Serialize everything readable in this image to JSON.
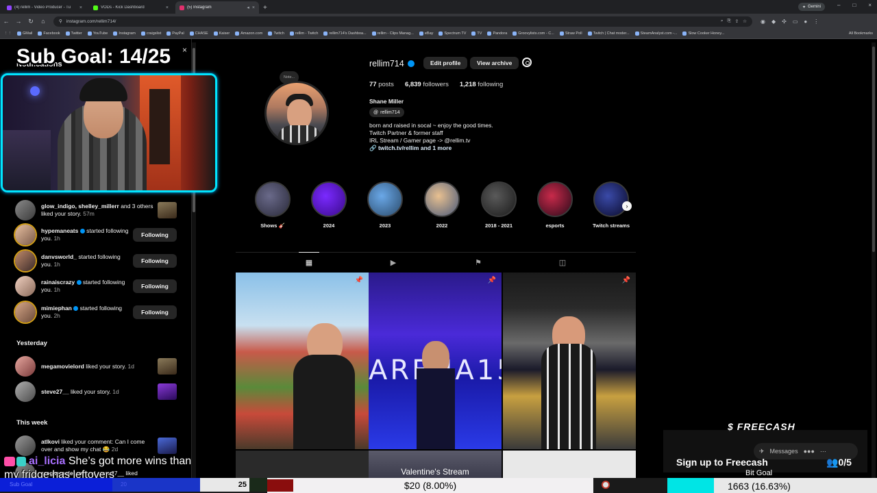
{
  "browser": {
    "tabs": [
      {
        "title": "(4) rellim - Video Producer - Tu",
        "favicon_color": "#9146ff",
        "active": false
      },
      {
        "title": "VODs - Kick Dashboard",
        "favicon_color": "#53fc18",
        "active": false
      },
      {
        "title": "(5) Instagram",
        "favicon_color": "#e1306c",
        "active": true
      }
    ],
    "new_tab_label": "+",
    "gemini_label": "Gemini",
    "url": "instagram.com/rellim714/",
    "window_controls": [
      "–",
      "□",
      "×"
    ],
    "bookmarks": [
      "GMail",
      "Facebook",
      "Twitter",
      "YouTube",
      "Instagram",
      "craigslist",
      "PayPal",
      "CHASE",
      "Kaiser",
      "Amazon.com",
      "Twitch",
      "rellim - Twitch",
      "rellim714's Dashboa...",
      "rellim - Clips Manag...",
      "eBay",
      "Spectrum TV",
      "TV",
      "Pandora",
      "Groovylists.com - C...",
      "Straw Poll",
      "Twitch | Chat moder...",
      "SteamAnalyst.com -...",
      "Slow Cooker Honey..."
    ],
    "all_bookmarks": "All Bookmarks"
  },
  "overlay": {
    "sub_goal_title": "Sub Goal: 14/25",
    "notifications_heading": "Notifications",
    "close_symbol": "×"
  },
  "notifications": {
    "items": [
      {
        "user": "glow_indigo, shelley_millerr",
        "text": " and 3 others liked your story.",
        "time": "57m",
        "action": "thumb"
      },
      {
        "user": "hypemaneats",
        "verified": true,
        "text": " started following you.",
        "time": "1h",
        "action": "Following"
      },
      {
        "user": "danvsworld_",
        "text": " started following you.",
        "time": "1h",
        "action": "Following"
      },
      {
        "user": "rainaiscrazy",
        "verified": true,
        "text": " started following you.",
        "time": "1h",
        "action": "Following"
      },
      {
        "user": "mimiephan",
        "verified": true,
        "text": " started following you.",
        "time": "2h",
        "action": "Following"
      }
    ],
    "yesterday_heading": "Yesterday",
    "yesterday": [
      {
        "user": "megamovielord",
        "text": " liked your story.",
        "time": "1d"
      },
      {
        "user": "steve27__",
        "text": " liked your story.",
        "time": "1d"
      }
    ],
    "week_heading": "This week",
    "week": [
      {
        "user": "atlkovi",
        "text": " liked your comment: Can I come over and show my chat ",
        "emoji": "😂",
        "time": "2d"
      },
      {
        "user": "megamovielord",
        "text": " and steve27__ liked",
        "time": ""
      }
    ]
  },
  "profile": {
    "username": "rellim714",
    "edit_profile": "Edit profile",
    "view_archive": "View archive",
    "note_label": "Note...",
    "posts_count": "77",
    "posts_label": "posts",
    "followers_count": "6,839",
    "followers_label": "followers",
    "following_count": "1,218",
    "following_label": "following",
    "full_name": "Shane Miller",
    "threads_handle": "rellim714",
    "bio_line1": "born and raised in socal ~ enjoy the good times.",
    "bio_line2": "Twitch Partner & former staff",
    "bio_line3": "IRL Stream / Gamer page -> @rellim.tv",
    "bio_link": "twitch.tv/rellim and 1 more"
  },
  "highlights": [
    {
      "label": "Shows 🎸",
      "colors": [
        "#6a6a8a",
        "#2a2a3a"
      ]
    },
    {
      "label": "2024",
      "colors": [
        "#7a2aff",
        "#3a0a8a"
      ]
    },
    {
      "label": "2023",
      "colors": [
        "#6aa8e8",
        "#2a4a6a"
      ]
    },
    {
      "label": "2022",
      "colors": [
        "#e8c090",
        "#4a5a7a"
      ]
    },
    {
      "label": "2018 - 2021",
      "colors": [
        "#5a5a5a",
        "#1a1a1a"
      ]
    },
    {
      "label": "esports",
      "colors": [
        "#c82a4a",
        "#2a0a1a"
      ]
    },
    {
      "label": "Twitch streams",
      "colors": [
        "#3a4aa8",
        "#0a0a2a"
      ]
    }
  ],
  "post_text": {
    "arena": "ARENA15",
    "valentines": "Valentine's Stream"
  },
  "widgets": {
    "freecash_logo": "FREECASH",
    "signup_text": "Sign up to Freecash",
    "messages_label": "Messages",
    "viewers": "0/5",
    "bit_goal_label": "Bit Goal"
  },
  "chat": {
    "name": "ai_licia",
    "message": "She’s got more wins than",
    "line2": "my fridge has leftovers"
  },
  "goals": {
    "sub_goal_label": "Sub Goal",
    "sub_goal_current": "20",
    "sub_goal_total": "25",
    "sub_goal_fraction": 0.56,
    "donation_label": "$20 (8.00%)",
    "donation_fraction": 0.08,
    "bit_label": "1663 (16.63%)",
    "bit_fraction": 0.1663
  },
  "colors": {
    "instagram_bg": "#000000",
    "verified": "#0095f6",
    "cam_border": "#00e5ff",
    "sub_goal_bar": "#1a35c8",
    "donation_fill": "#8a0d0d",
    "bit_fill": "#00e5e5"
  }
}
